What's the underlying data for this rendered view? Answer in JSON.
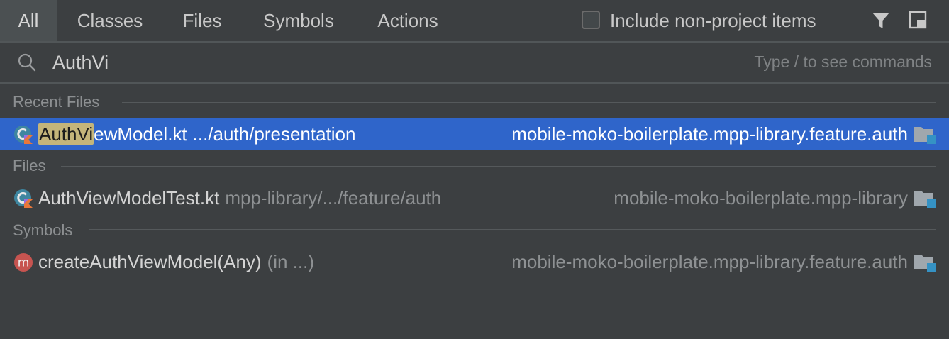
{
  "tabs": [
    {
      "label": "All",
      "active": true
    },
    {
      "label": "Classes",
      "active": false
    },
    {
      "label": "Files",
      "active": false
    },
    {
      "label": "Symbols",
      "active": false
    },
    {
      "label": "Actions",
      "active": false
    }
  ],
  "options": {
    "include_non_project_label": "Include non-project items",
    "include_non_project_checked": false
  },
  "search": {
    "value": "AuthVi",
    "hint": "Type / to see commands"
  },
  "sections": {
    "recent_files": {
      "header": "Recent Files",
      "items": [
        {
          "match": "AuthVi",
          "rest": "ewModel.kt",
          "path": ".../auth/presentation",
          "module": "mobile-moko-boilerplate.mpp-library.feature.auth",
          "selected": true
        }
      ]
    },
    "files": {
      "header": "Files",
      "items": [
        {
          "name": "AuthViewModelTest.kt",
          "path": "mpp-library/.../feature/auth",
          "module": "mobile-moko-boilerplate.mpp-library"
        }
      ]
    },
    "symbols": {
      "header": "Symbols",
      "items": [
        {
          "name": "createAuthViewModel(Any)",
          "path": "(in ...)",
          "module": "mobile-moko-boilerplate.mpp-library.feature.auth",
          "icon_letter": "m"
        }
      ]
    }
  },
  "colors": {
    "background": "#3c3f41",
    "selection": "#2f65ca",
    "match_highlight": "#c4b57a",
    "method_icon": "#c75450"
  }
}
